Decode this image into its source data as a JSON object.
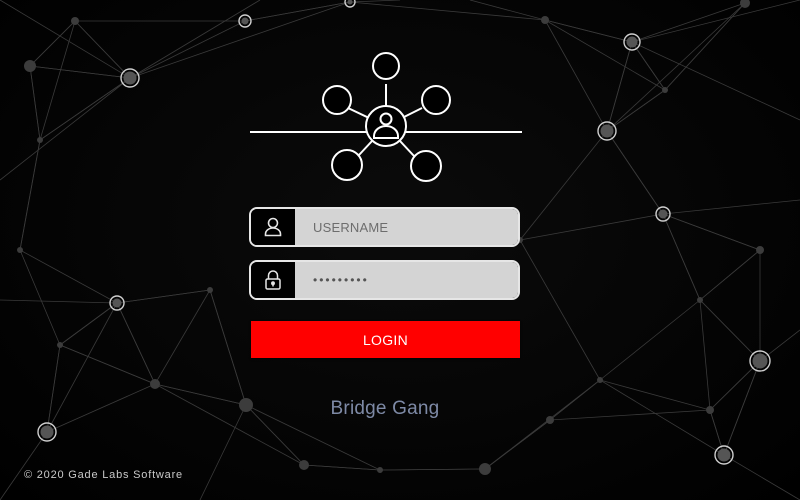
{
  "login": {
    "username_placeholder": "USERNAME",
    "password_value": "•••••••••",
    "login_label": "LOGIN"
  },
  "brand": {
    "name": "Bridge Gang",
    "copyright": "© 2020 Gade Labs Software"
  },
  "icons": {
    "logo": "network-user-icon",
    "username": "user-icon",
    "password": "padlock-icon"
  },
  "colors": {
    "background": "#000000",
    "login_button": "#ff0000",
    "brand_text": "#7e8aa6",
    "field_fill": "#d4d4d4"
  }
}
